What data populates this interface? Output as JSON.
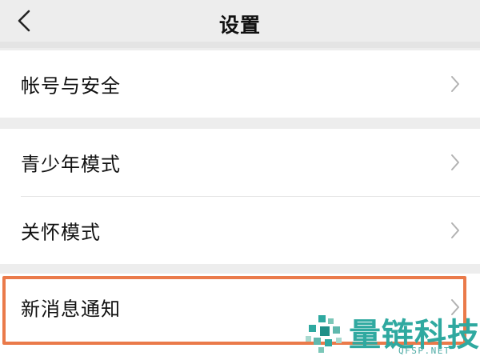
{
  "header": {
    "title": "设置",
    "back_icon": "chevron-left-icon"
  },
  "groups": [
    {
      "items": [
        {
          "label": "帐号与安全",
          "icon": "chevron-right-icon"
        }
      ]
    },
    {
      "items": [
        {
          "label": "青少年模式",
          "icon": "chevron-right-icon"
        },
        {
          "label": "关怀模式",
          "icon": "chevron-right-icon"
        }
      ]
    },
    {
      "items": [
        {
          "label": "新消息通知",
          "icon": "chevron-right-icon",
          "highlighted": true
        }
      ]
    }
  ],
  "colors": {
    "background": "#ededed",
    "cell": "#ffffff",
    "highlight_border": "#ea7a4a",
    "watermark": "#2fa9a0"
  },
  "watermark": {
    "text": "量链科技",
    "subtext": "QFSP.NET"
  }
}
